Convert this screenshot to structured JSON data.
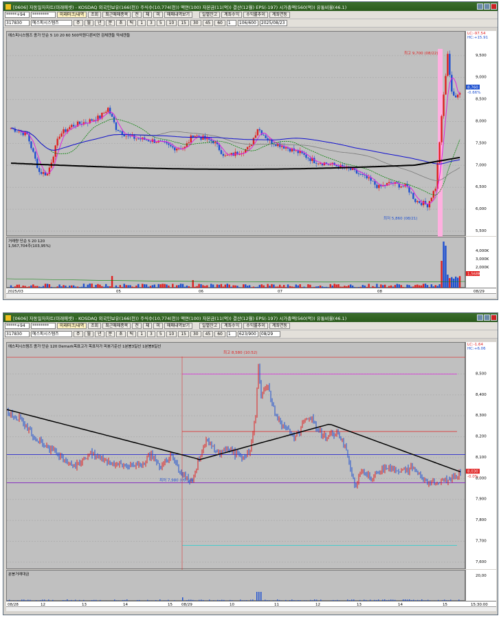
{
  "top": {
    "title": "[0606] 자동일자차트(미래에셋) - KOSDAQ 외국인보유(166(천)) 주식수(10,774(천)) 액면(100) 자본금(11(억)) 결산(12월) EPS(-197) 시가총액(560(억)) 유통비율(46.1)",
    "code": "317830",
    "name": "에스피시스템즈",
    "account": "*****+94",
    "pw": "********",
    "buttons": [
      "미래마크/내역",
      "조회",
      "최근매매종목",
      "전",
      "체",
      "미",
      "매매내역보기",
      "일별잔고",
      "계좌수익",
      "수익률추이",
      "계좌연동"
    ],
    "periods": [
      "주",
      "월",
      "년",
      "분",
      "초",
      "틱",
      "1",
      "3",
      "5",
      "10",
      "15",
      "30",
      "45",
      "60",
      "1"
    ],
    "count": "106/600",
    "date": "2025/08/23",
    "legend": "에스피시스템즈 종가 단순 5  10  20  60  500억원디른비연 검체캔들 약세캔들",
    "vol_legend": "거래량 단순 5  20  120",
    "vol_value": "1,567,704주(103,95%)",
    "high_label": "최고 9,700 (08/22)",
    "low_label": "최저 5,860 (08/21)",
    "lc": "LC:-97.54",
    "hc": "HC:+15.91",
    "yticks": [
      "9,500",
      "9,000",
      "8,500",
      "8,000",
      "7,500",
      "7,000",
      "6,500",
      "6,000",
      "5,500"
    ],
    "price_tag": "8,760",
    "price_pct": "-0.66%",
    "vticks": [
      "4,000K",
      "3,000K",
      "2,000K"
    ],
    "vol_tag": "1,568K",
    "x_labels": [
      "2025/03",
      "05",
      "06",
      "07",
      "08"
    ],
    "x_last": "08/29",
    "colors": {
      "up": "#e02020",
      "down": "#1e50d0",
      "ma5": "#e020e0",
      "ma20": "#008000",
      "ma60": "#7a7a7a",
      "ma120": "#1010d0",
      "ma500": "#000000"
    }
  },
  "bottom": {
    "title": "[0606] 자동일자차트(미래에셋) - KOSDAQ 외국인보유(166(천)) 주식수(10,774(천)) 액면(100) 자본금(11(억)) 결산(12월) EPS(-197) 시가총액(560(억)) 유통비율(46.1)",
    "code": "317830",
    "name": "에스피시스템즈",
    "account": "*****+94",
    "pw": "********",
    "count": "623/900",
    "date": "08/29",
    "legend": "에스피시스템즈 종가 단순 120 Demark목표고가 목표저가 피봇기준선 1분봉3일선 1분봉8일선",
    "vol_legend": "분봉거래대금",
    "high_label": "최고 8,580 (10:52)",
    "low_label": "최저 7,980 (09:18)",
    "lc": "LC:-1.64",
    "hc": "HC:+6.06",
    "yticks": [
      "8,500",
      "8,400",
      "8,300",
      "8,200",
      "8,100",
      "8,000",
      "7,900",
      "7,800",
      "7,700",
      "7,600"
    ],
    "price_tag": "8,030",
    "price_pct": "-0.0%",
    "vtick": "20,00",
    "x_labels": [
      "08/28",
      "12",
      "13",
      "14",
      "15",
      "08/29",
      "10",
      "11",
      "12",
      "13",
      "14",
      "15"
    ],
    "x_last": "15:30:00"
  }
}
